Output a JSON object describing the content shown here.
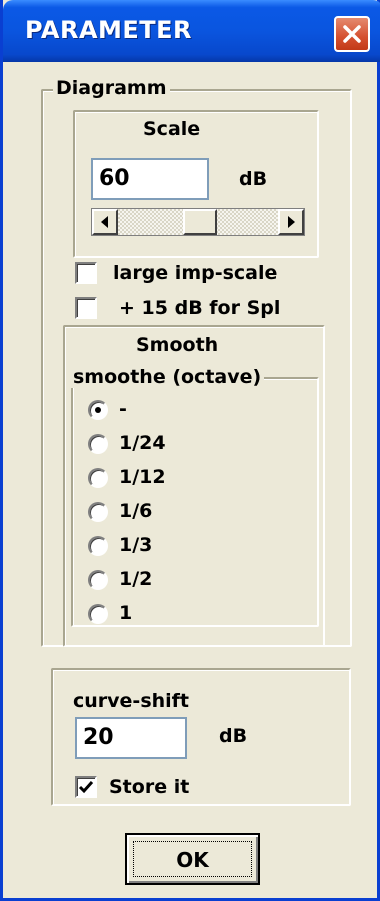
{
  "window": {
    "title": "PARAMETER",
    "title_color": "#ffffff",
    "titlebar_color": "#0a55df",
    "close_icon": "close-icon"
  },
  "diagramm": {
    "legend": "Diagramm",
    "scale": {
      "legend": "Scale",
      "value": "60",
      "unit": "dB",
      "slider_position": 0.5
    },
    "large_imp_scale": {
      "label": "large imp-scale",
      "checked": false
    },
    "spl_boost": {
      "label": "+ 15 dB for Spl",
      "checked": false
    },
    "smooth": {
      "legend": "Smooth",
      "group_label": "smoothe (octave)",
      "options": [
        "-",
        "1/24",
        "1/12",
        "1/6",
        "1/3",
        "1/2",
        "1"
      ],
      "selected": "-"
    }
  },
  "curve_shift": {
    "label": "curve-shift",
    "value": "20",
    "unit": "dB",
    "store": {
      "label": "Store it",
      "checked": true
    }
  },
  "ok_button": {
    "label": "OK"
  }
}
